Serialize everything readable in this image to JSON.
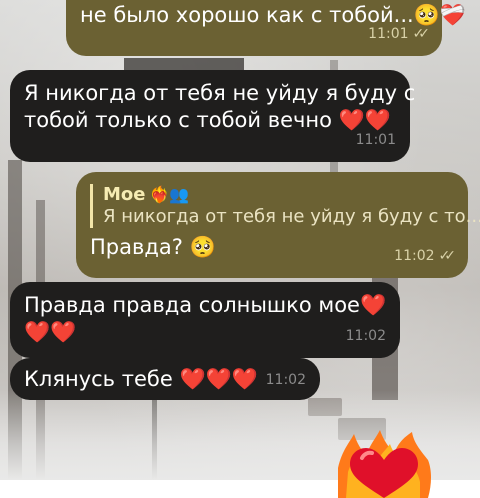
{
  "chat": {
    "messages": [
      {
        "direction": "outgoing",
        "text": "не было хорошо как с тобой...",
        "emoji": "🥺❤️‍🩹",
        "time": "11:01",
        "status_icon": "double-check-icon"
      },
      {
        "direction": "incoming",
        "text_line1": "Я никогда от тебя не уйду я буду с",
        "text_line2": "тобой только с тобой вечно",
        "emoji": "❤️❤️",
        "time": "11:01"
      },
      {
        "direction": "outgoing",
        "reply_to": {
          "name": "Мое",
          "name_emoji": "❤️‍🔥👥",
          "preview": "Я никогда от тебя не уйду я буду с то..."
        },
        "text": "Правда?",
        "emoji": "🥺",
        "time": "11:02",
        "status_icon": "double-check-icon"
      },
      {
        "direction": "incoming",
        "text_line1": "Правда правда солнышко мое",
        "emoji_line1": "❤️",
        "emoji_line2": "❤️❤️",
        "time": "11:02"
      },
      {
        "direction": "incoming",
        "text": "Клянусь тебе",
        "emoji": "❤️❤️❤️",
        "time": "11:02"
      }
    ],
    "sticker": "burning-heart-sticker"
  },
  "colors": {
    "outgoing_bubble": "#6b6133",
    "incoming_bubble": "#1f1e1d",
    "reply_accent": "#f2e5a8"
  }
}
